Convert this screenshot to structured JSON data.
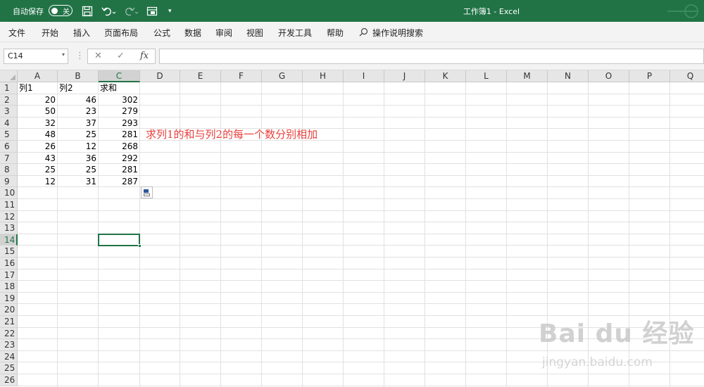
{
  "titlebar": {
    "autosave_label": "自动保存",
    "autosave_state": "关",
    "title": "工作簿1 - Excel",
    "save_icon": "save-icon",
    "undo_icon": "undo-icon",
    "redo_icon": "redo-icon",
    "form_icon": "form-icon",
    "more_icon": "customize-dropdown-icon",
    "accent_color": "#217346"
  },
  "menu": {
    "items": [
      "文件",
      "开始",
      "插入",
      "页面布局",
      "公式",
      "数据",
      "审阅",
      "视图",
      "开发工具",
      "帮助"
    ],
    "search_label": "操作说明搜索"
  },
  "formula_bar": {
    "name_box": "C14",
    "cancel_icon": "✕",
    "enter_icon": "✓",
    "fx_icon": "fx",
    "value": ""
  },
  "sheet": {
    "columns": [
      "A",
      "B",
      "C",
      "D",
      "E",
      "F",
      "G",
      "H",
      "I",
      "J",
      "K",
      "L",
      "M",
      "N",
      "O",
      "P",
      "Q"
    ],
    "rows": [
      "1",
      "2",
      "3",
      "4",
      "5",
      "6",
      "7",
      "8",
      "9",
      "10",
      "11",
      "12",
      "13",
      "14",
      "15",
      "16",
      "17",
      "18",
      "19",
      "20",
      "21",
      "22",
      "23",
      "24",
      "25",
      "26"
    ],
    "selected_cell": "C14",
    "headers": [
      "列1",
      "列2",
      "求和"
    ],
    "data": [
      [
        20,
        46,
        302
      ],
      [
        50,
        23,
        279
      ],
      [
        32,
        37,
        293
      ],
      [
        48,
        25,
        281
      ],
      [
        26,
        12,
        268
      ],
      [
        43,
        36,
        292
      ],
      [
        25,
        25,
        281
      ],
      [
        12,
        31,
        287
      ]
    ],
    "annotation": "求列1的和与列2的每一个数分别相加",
    "annotation_color": "#e8413d"
  },
  "watermark": {
    "main": "Bai du 经验",
    "sub": "jingyan.baidu.com"
  }
}
